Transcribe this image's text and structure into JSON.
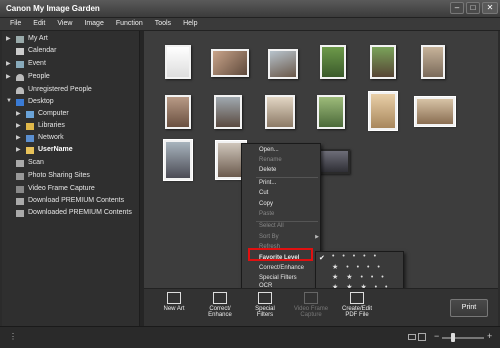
{
  "app": {
    "title": "Canon My Image Garden"
  },
  "menubar": [
    "File",
    "Edit",
    "View",
    "Image",
    "Function",
    "Tools",
    "Help"
  ],
  "sidebar": {
    "items": [
      {
        "label": "My Art",
        "arrow": "▶",
        "icon": "my-art-icon"
      },
      {
        "label": "Calendar",
        "arrow": "",
        "icon": "calendar-icon"
      },
      {
        "label": "Event",
        "arrow": "▶",
        "icon": "event-icon"
      },
      {
        "label": "People",
        "arrow": "▶",
        "icon": "people-icon"
      },
      {
        "label": "Unregistered People",
        "arrow": "",
        "icon": "unregistered-people-icon"
      },
      {
        "label": "Desktop",
        "arrow": "▼",
        "icon": "desktop-icon"
      },
      {
        "label": "Computer",
        "arrow": "▶",
        "icon": "computer-icon"
      },
      {
        "label": "Libraries",
        "arrow": "▶",
        "icon": "libraries-icon"
      },
      {
        "label": "Network",
        "arrow": "▶",
        "icon": "network-icon"
      },
      {
        "label": "UserName",
        "arrow": "▶",
        "icon": "folder-icon"
      },
      {
        "label": "Scan",
        "arrow": "",
        "icon": "scan-icon"
      },
      {
        "label": "Photo Sharing Sites",
        "arrow": "",
        "icon": "photo-sharing-icon"
      },
      {
        "label": "Video Frame Capture",
        "arrow": "",
        "icon": "video-frame-icon"
      },
      {
        "label": "Download PREMIUM Contents",
        "arrow": "",
        "icon": "download-icon"
      },
      {
        "label": "Downloaded PREMIUM Contents",
        "arrow": "",
        "icon": "downloaded-icon"
      }
    ]
  },
  "context_menu": {
    "items": [
      {
        "label": "Open...",
        "enabled": true
      },
      {
        "label": "Rename",
        "enabled": false
      },
      {
        "label": "Delete",
        "enabled": true
      },
      {
        "label": "Print...",
        "enabled": true
      },
      {
        "label": "Cut",
        "enabled": true
      },
      {
        "label": "Copy",
        "enabled": true
      },
      {
        "label": "Paste",
        "enabled": false
      },
      {
        "label": "Select All",
        "enabled": false
      },
      {
        "label": "Sort By",
        "enabled": false
      },
      {
        "label": "Refresh",
        "enabled": false
      },
      {
        "label": "Favorite Level",
        "enabled": true
      },
      {
        "label": "Correct/Enhance",
        "enabled": true
      },
      {
        "label": "Special Filters",
        "enabled": true
      },
      {
        "label": "OCR",
        "enabled": true
      }
    ],
    "submenu_arrow": "▶"
  },
  "favorite_submenu": {
    "levels": [
      "• • • • •",
      "★ • • • •",
      "★ ★ • • •",
      "★ ★ ★ • •",
      "★ ★ ★ ★ •",
      "★ ★ ★ ★ ★"
    ],
    "checked_index": 0,
    "check": "✔"
  },
  "toolbar": {
    "new_art": "New Art",
    "correct_1": "Correct/",
    "correct_2": "Enhance",
    "special_1": "Special",
    "special_2": "Filters",
    "video_1": "Video Frame",
    "video_2": "Capture",
    "pdf_1": "Create/Edit",
    "pdf_2": "PDF File",
    "print": "Print"
  },
  "colors": {
    "accent_highlight": "#e01010",
    "background": "#3d3d3d"
  }
}
